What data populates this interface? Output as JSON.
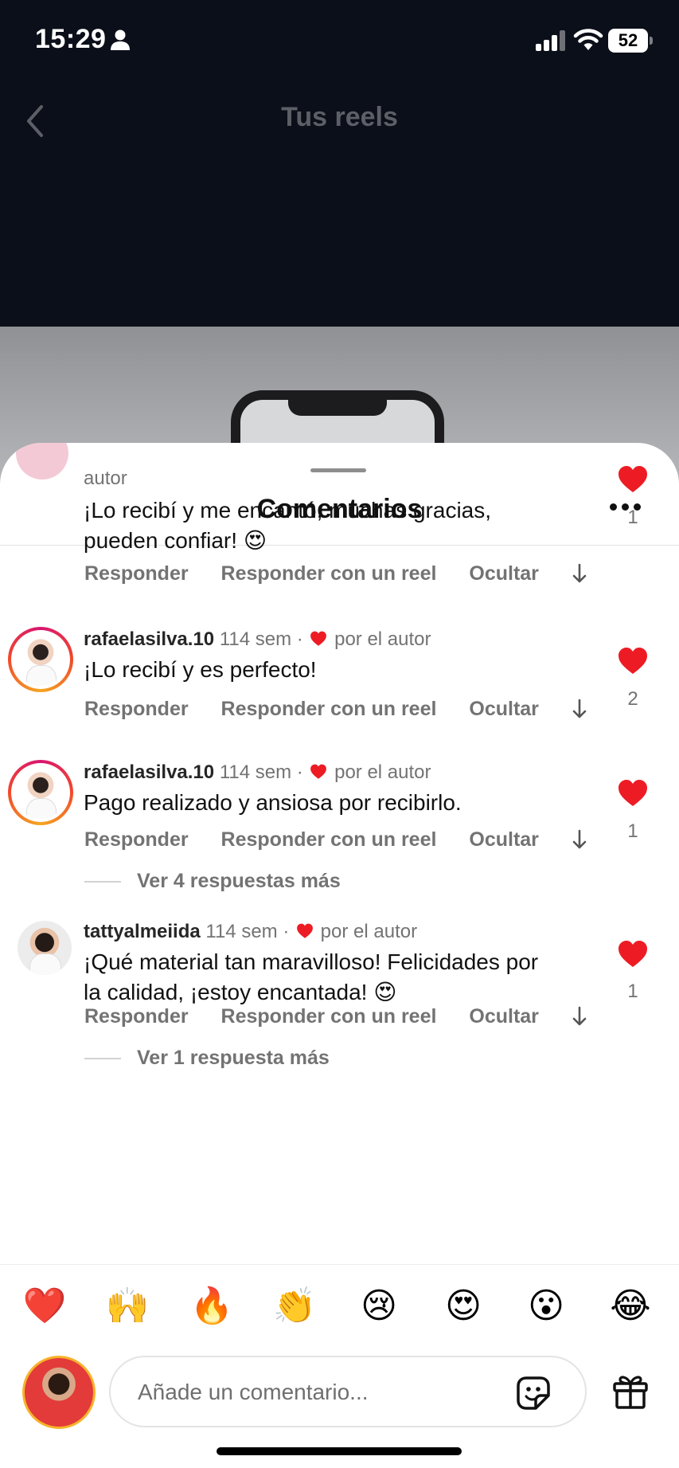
{
  "status": {
    "time": "15:29",
    "battery": "52"
  },
  "nav": {
    "title": "Tus reels"
  },
  "sheet": {
    "title": "Comentarios"
  },
  "comments": [
    {
      "meta_tail": "autor",
      "text_line1": "¡Lo recibí y me encantó, muchas gracias,",
      "text_line2": "pueden confiar! 😍",
      "like_count": "1",
      "actions": [
        "Responder",
        "Responder con un reel",
        "Ocultar"
      ]
    },
    {
      "user": "rafaelasilva.10",
      "time": "114 sem ·",
      "by_author": "por el autor",
      "text": "¡Lo recibí y es perfecto!",
      "like_count": "2",
      "actions": [
        "Responder",
        "Responder con un reel",
        "Ocultar"
      ]
    },
    {
      "user": "rafaelasilva.10",
      "time": "114 sem ·",
      "by_author": "por el autor",
      "text": "Pago realizado y ansiosa por recibirlo.",
      "like_count": "1",
      "actions": [
        "Responder",
        "Responder con un reel",
        "Ocultar"
      ],
      "more_replies": "Ver 4 respuestas más"
    },
    {
      "user": "tattyalmeiida",
      "time": "114 sem ·",
      "by_author": "por el autor",
      "text_line1": "¡Qué material tan maravilloso! Felicidades por",
      "text_line2": "la calidad, ¡estoy encantada! 😍",
      "like_count": "1",
      "actions": [
        "Responder",
        "Responder con un reel",
        "Ocultar"
      ],
      "more_replies": "Ver 1 respuesta más"
    }
  ],
  "emojis": [
    "❤️",
    "🙌",
    "🔥",
    "👏",
    "😢",
    "😍",
    "😮",
    "😂"
  ],
  "composer": {
    "placeholder": "Añade un comentario..."
  },
  "colors": {
    "like": "#ed1c24",
    "dark_bg": "#0b0f19"
  },
  "icons": [
    "person-icon",
    "signal-icon",
    "wifi-icon",
    "battery-icon",
    "back-chevron-icon",
    "more-options-icon",
    "heart-icon",
    "down-arrow-icon",
    "sticker-icon",
    "gift-icon"
  ]
}
